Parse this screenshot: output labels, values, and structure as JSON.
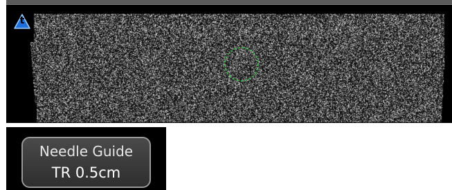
{
  "scan_view": {
    "orientation_marker": {
      "icon": "orientation-marker-icon",
      "letter": "t",
      "color": "#1e6fd9"
    },
    "needle_target": {
      "icon": "dashed-circle-target-icon",
      "color": "#2ecc40"
    }
  },
  "needle_guide": {
    "title": "Needle Guide",
    "value": "TR 0.5cm"
  }
}
